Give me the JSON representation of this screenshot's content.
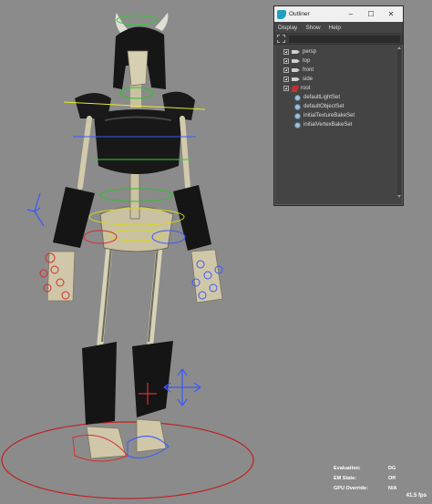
{
  "outliner": {
    "title": "Outliner",
    "controls": {
      "minimize": "–",
      "maximize": "☐",
      "close": "✕"
    },
    "menu": [
      "Display",
      "Show",
      "Help"
    ],
    "items": [
      {
        "label": "persp",
        "icon": "camera-icon",
        "expandable": true
      },
      {
        "label": "top",
        "icon": "camera-icon",
        "expandable": true
      },
      {
        "label": "front",
        "icon": "camera-icon",
        "expandable": true
      },
      {
        "label": "side",
        "icon": "camera-icon",
        "expandable": true
      },
      {
        "label": "root",
        "icon": "joint-icon",
        "expandable": true
      },
      {
        "label": "defaultLightSet",
        "icon": "set-icon",
        "expandable": false
      },
      {
        "label": "defaultObjectSet",
        "icon": "set-icon",
        "expandable": false
      },
      {
        "label": "initialTextureBakeSet",
        "icon": "set-icon",
        "expandable": false
      },
      {
        "label": "initialVertexBakeSet",
        "icon": "set-icon",
        "expandable": false
      }
    ]
  },
  "hud": {
    "rows": [
      {
        "label": "Evaluation:",
        "value": "DG"
      },
      {
        "label": "EM State:",
        "value": "Off"
      },
      {
        "label": "GPU Override:",
        "value": "N/A"
      }
    ],
    "fps": "41.5 fps"
  },
  "colors": {
    "viewport_bg": "#8b8b8b",
    "panel_bg": "#444444",
    "titlebar_bg": "#f0f0f0"
  }
}
